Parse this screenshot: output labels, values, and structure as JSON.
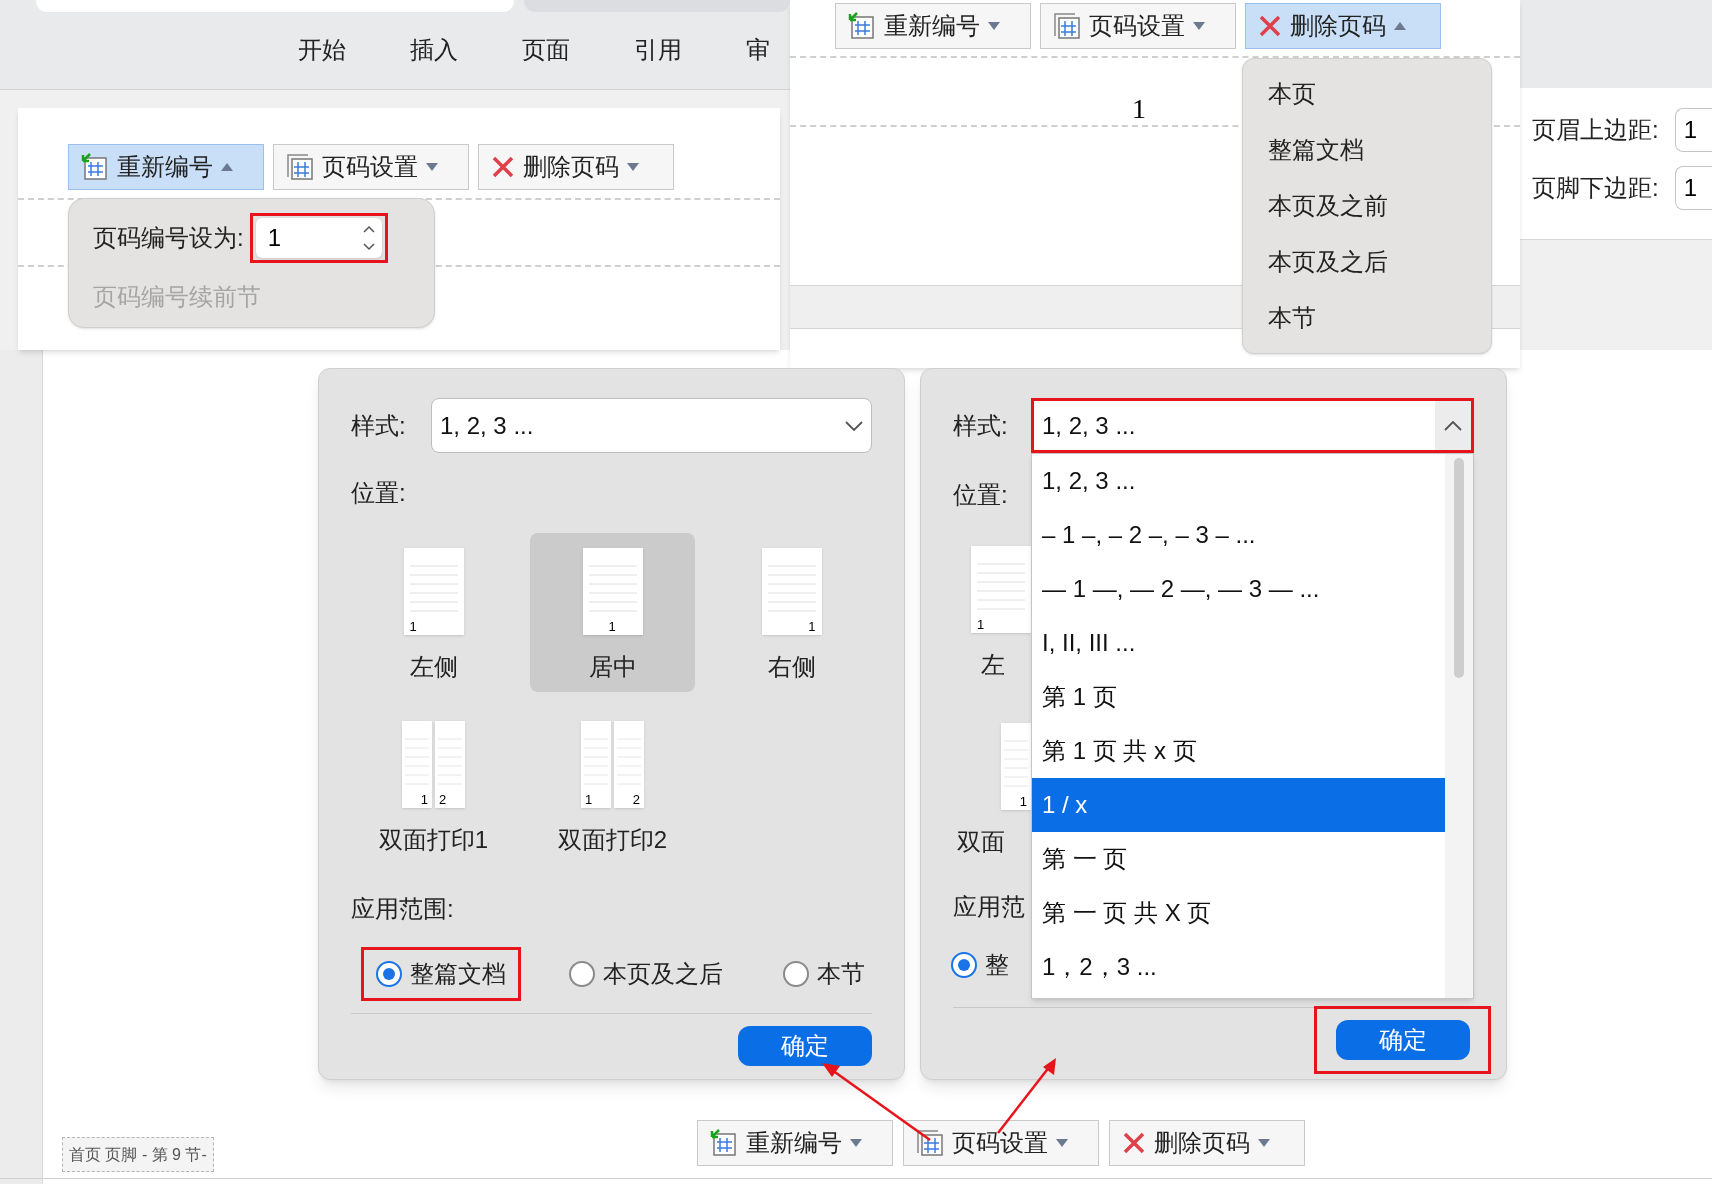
{
  "ribbon": {
    "tabs": [
      "开始",
      "插入",
      "页面",
      "引用",
      "审"
    ]
  },
  "renumber_panel": {
    "toolbar": [
      {
        "kind": "renumber",
        "label": "重新编号",
        "expanded": true
      },
      {
        "kind": "settings",
        "label": "页码设置",
        "expanded": false
      },
      {
        "kind": "delete",
        "label": "删除页码",
        "expanded": false
      }
    ],
    "popup": {
      "label": "页码编号设为:",
      "value": "1",
      "highlighted": true,
      "continue_label": "页码编号续前节",
      "continue_disabled": true
    }
  },
  "delete_panel": {
    "toolbar": [
      {
        "kind": "renumber",
        "label": "重新编号",
        "expanded": false
      },
      {
        "kind": "settings",
        "label": "页码设置",
        "expanded": false
      },
      {
        "kind": "delete",
        "label": "删除页码",
        "expanded": true
      }
    ],
    "page_number": "1",
    "menu": [
      "本页",
      "整篇文档",
      "本页及之前",
      "本页及之后",
      "本节"
    ]
  },
  "margins": [
    {
      "label": "页眉上边距:",
      "value": "1"
    },
    {
      "label": "页脚下边距:",
      "value": "1"
    }
  ],
  "dialog_left": {
    "style_label": "样式:",
    "style_value": "1, 2, 3 ...",
    "position_label": "位置:",
    "positions": [
      {
        "kind": "left",
        "label": "左侧",
        "page_numbers": [
          "1"
        ],
        "selected": false
      },
      {
        "kind": "center",
        "label": "居中",
        "page_numbers": [
          "1"
        ],
        "selected": true
      },
      {
        "kind": "right",
        "label": "右侧",
        "page_numbers": [
          "1"
        ],
        "selected": false
      },
      {
        "kind": "duplex1",
        "label": "双面打印1",
        "page_numbers": [
          "1",
          "2"
        ],
        "selected": false
      },
      {
        "kind": "duplex2",
        "label": "双面打印2",
        "page_numbers": [
          "1",
          "2"
        ],
        "selected": false
      }
    ],
    "scope_label": "应用范围:",
    "scopes": [
      {
        "label": "整篇文档",
        "selected": true,
        "highlighted": true
      },
      {
        "label": "本页及之后",
        "selected": false
      },
      {
        "label": "本节",
        "selected": false
      }
    ],
    "ok": "确定"
  },
  "dialog_right": {
    "style_label": "样式:",
    "style_value": "1, 2, 3 ...",
    "style_highlighted": true,
    "position_label": "位置:",
    "positions": [
      {
        "kind": "left",
        "label": "左",
        "page_numbers": [
          "1"
        ]
      },
      {
        "kind": "duplex1",
        "label": "双面",
        "page_numbers": [
          "1"
        ]
      }
    ],
    "scope_label": "应用范",
    "scopes": [
      {
        "label": "整",
        "selected": true
      }
    ],
    "options": [
      {
        "label": "1, 2, 3 ...",
        "selected": false
      },
      {
        "label": "– 1 –, – 2 –, – 3 – ...",
        "selected": false
      },
      {
        "label": "— 1 —, — 2 —, — 3 — ...",
        "selected": false
      },
      {
        "label": "I, II, III ...",
        "selected": false
      },
      {
        "label": "第 1 页",
        "selected": false
      },
      {
        "label": "第 1 页 共 x 页",
        "selected": false
      },
      {
        "label": "1 / x",
        "selected": true
      },
      {
        "label": "第 一 页",
        "selected": false
      },
      {
        "label": "第 一 页 共 X 页",
        "selected": false
      },
      {
        "label": "1，2，3 ...",
        "selected": false
      }
    ],
    "ok": "确定",
    "ok_highlighted": true
  },
  "footer_tag": "首页 页脚 - 第 9 节-",
  "bottom_toolbar": [
    {
      "kind": "renumber",
      "label": "重新编号",
      "expanded": false
    },
    {
      "kind": "settings",
      "label": "页码设置",
      "expanded": false
    },
    {
      "kind": "delete",
      "label": "删除页码",
      "expanded": false
    }
  ]
}
